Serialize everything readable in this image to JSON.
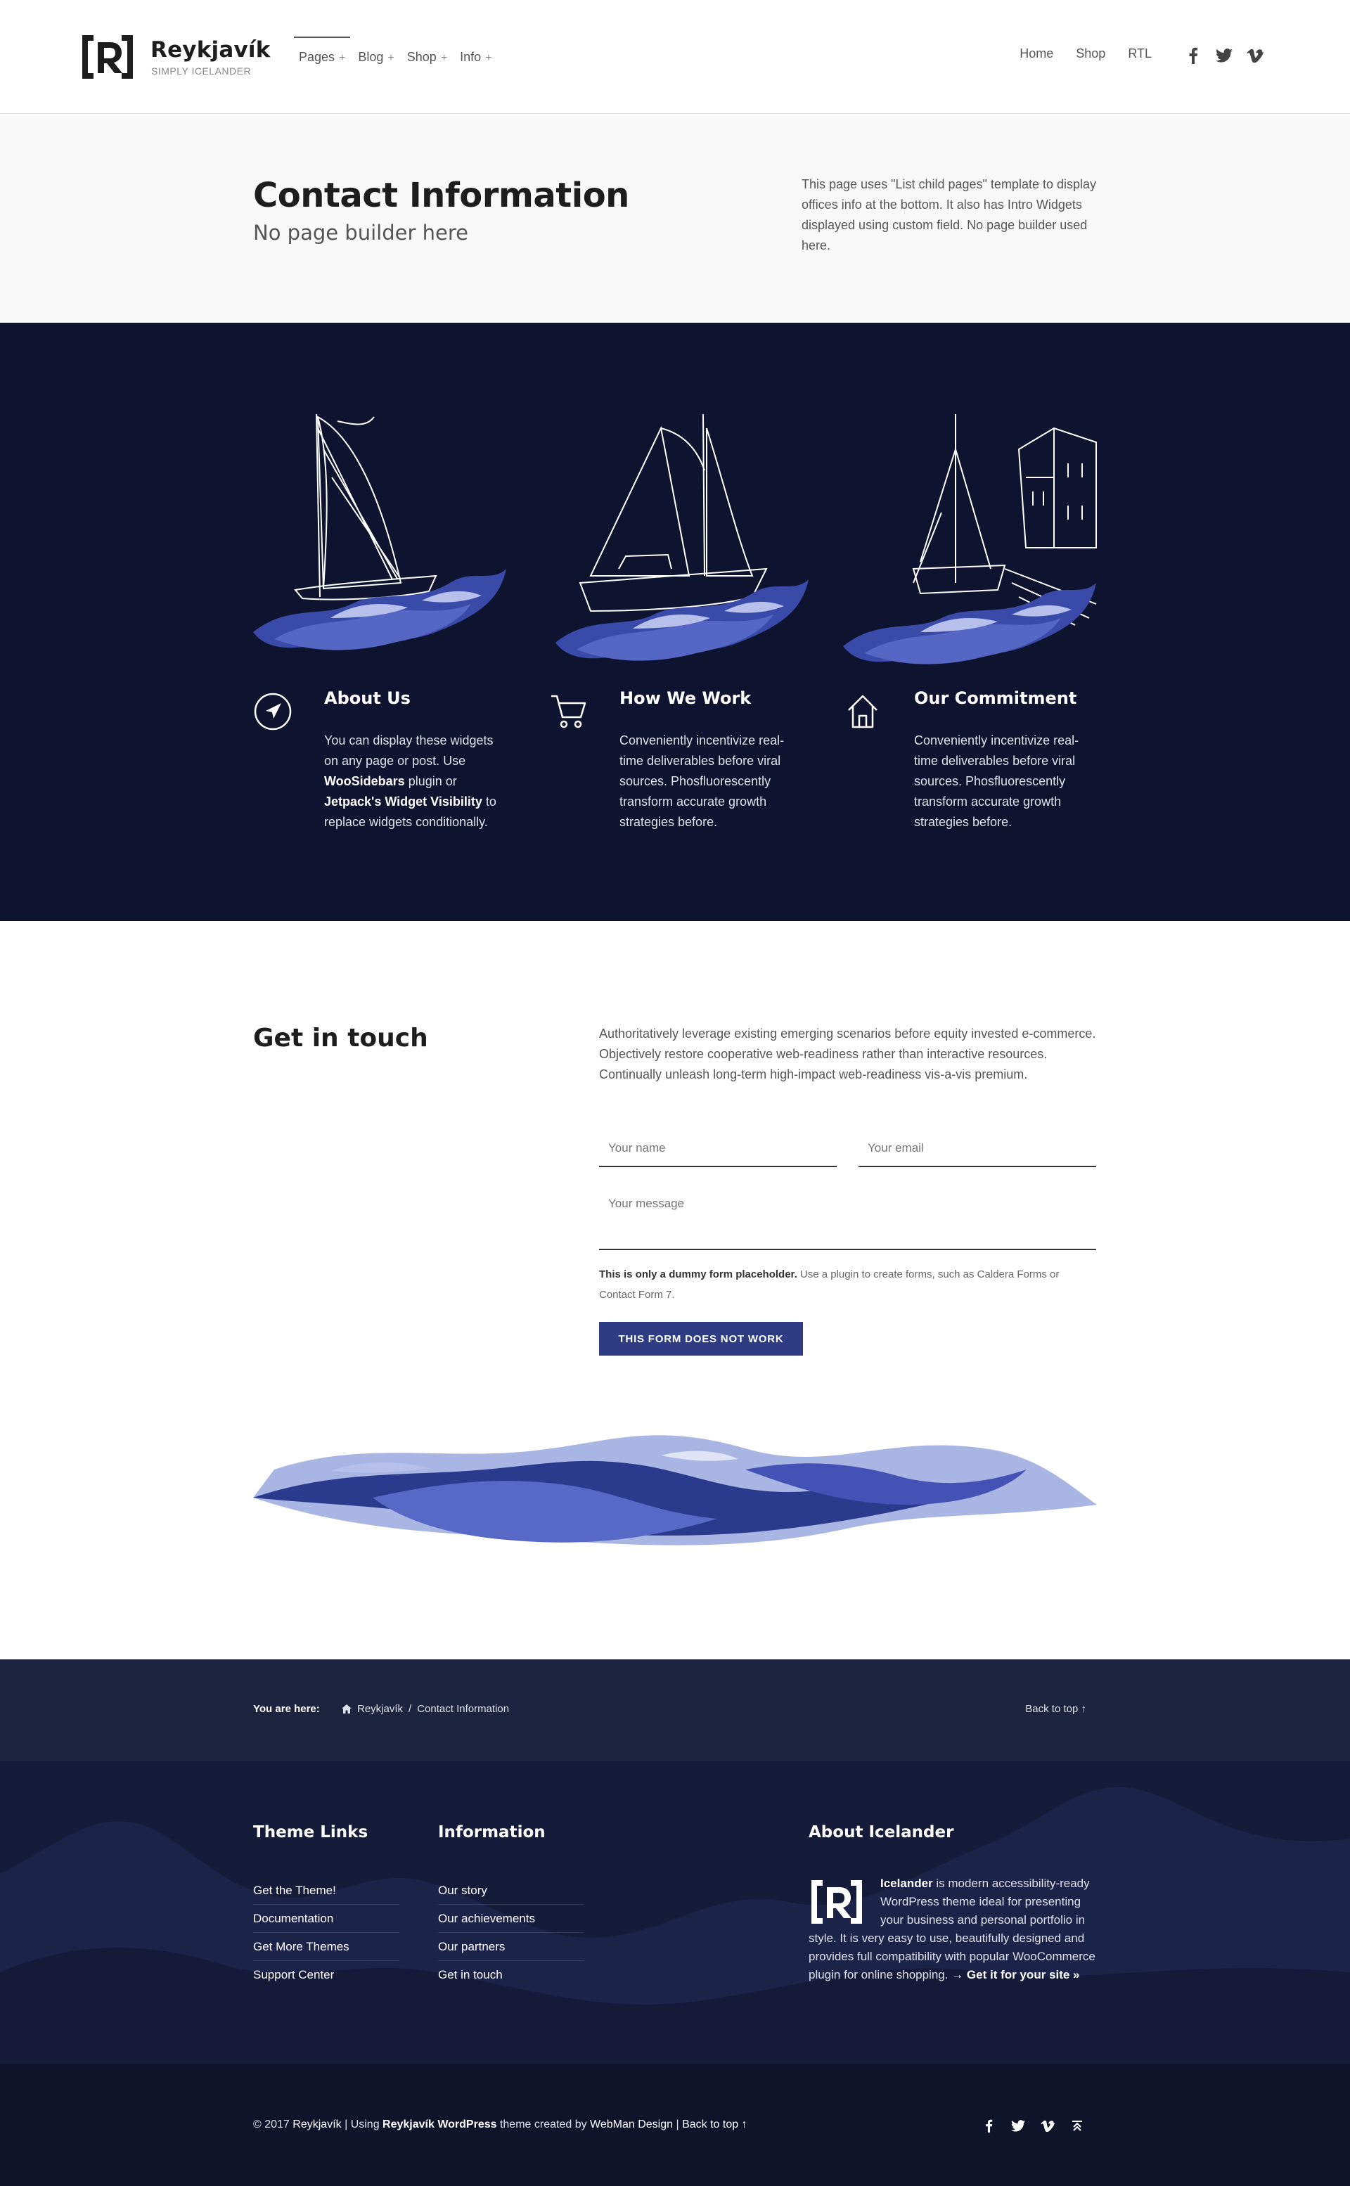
{
  "site": {
    "title": "Reykjavík",
    "tagline": "SIMPLY ICELANDER",
    "accent": "#2e3c84",
    "dark_bg": "#0e1430"
  },
  "nav": {
    "primary": [
      {
        "label": "Pages",
        "plus": "+"
      },
      {
        "label": "Blog",
        "plus": "+"
      },
      {
        "label": "Shop",
        "plus": "+"
      },
      {
        "label": "Info",
        "plus": "+"
      }
    ],
    "secondary": [
      "Home",
      "Shop",
      "RTL"
    ],
    "social": [
      "facebook-icon",
      "twitter-icon",
      "vimeo-icon"
    ]
  },
  "intro": {
    "title": "Contact Information",
    "subtitle": "No page builder here",
    "description": "This page uses \"List child pages\" template to display offices info at the bottom. It also has Intro Widgets displayed using custom field. No page builder used here."
  },
  "features": [
    {
      "icon": "compass-arrow-icon",
      "title": "About Us",
      "text_1": "You can display these widgets on any page or post. Use ",
      "link_1": "WooSidebars",
      "text_2": " plugin or ",
      "link_2": "Jetpack's Widget Visibility",
      "text_3": " to replace widgets conditionally."
    },
    {
      "icon": "shopping-cart-icon",
      "title": "How We Work",
      "text": "Conveniently incentivize real-time deliverables before viral sources. Phosfluorescently transform accurate growth strategies before."
    },
    {
      "icon": "home-icon",
      "title": "Our Commitment",
      "text": "Conveniently incentivize real-time deliverables before viral sources. Phosfluorescently transform accurate growth strategies before."
    }
  ],
  "contact": {
    "title": "Get in touch",
    "lead": "Authoritatively leverage existing emerging scenarios before equity invested e-commerce. Objectively restore cooperative web-readiness rather than interactive resources. Continually unleash long-term high-impact web-readiness vis-a-vis premium.",
    "name_placeholder": "Your name",
    "email_placeholder": "Your email",
    "message_placeholder": "Your message",
    "note_bold": "This is only a dummy form placeholder.",
    "note": " Use a plugin to create forms, such as Caldera Forms or Contact Form 7.",
    "button": "THIS FORM DOES NOT WORK"
  },
  "breadcrumbs": {
    "label": "You are here:",
    "home": "Reykjavík",
    "separator": "/",
    "current": "Contact Information",
    "back_to_top": "Back to top ↑"
  },
  "footer": {
    "theme_links": {
      "title": "Theme Links",
      "items": [
        "Get the Theme!",
        "Documentation",
        "Get More Themes",
        "Support Center"
      ]
    },
    "information": {
      "title": "Information",
      "items": [
        "Our story",
        "Our achievements",
        "Our partners",
        "Get in touch"
      ]
    },
    "about": {
      "title": "About Icelander",
      "name": "Icelander",
      "text": " is modern accessibility-ready WordPress theme ideal for presenting your business and personal portfolio in style. It is very easy to use, beautifully designed and provides full compatibility with popular WooCommerce plugin for online shopping. ",
      "cta": "→ Get it for your site »"
    }
  },
  "bottom": {
    "copy_1": "© 2017 ",
    "site": "Reykjavík",
    "copy_2": " | Using ",
    "theme": "Reykjavík WordPress",
    "copy_3": " theme created by ",
    "author": "WebMan Design",
    "copy_4": " | ",
    "back": "Back to top ↑",
    "social": [
      "facebook-icon",
      "twitter-icon",
      "vimeo-icon",
      "back-to-top-icon"
    ]
  }
}
